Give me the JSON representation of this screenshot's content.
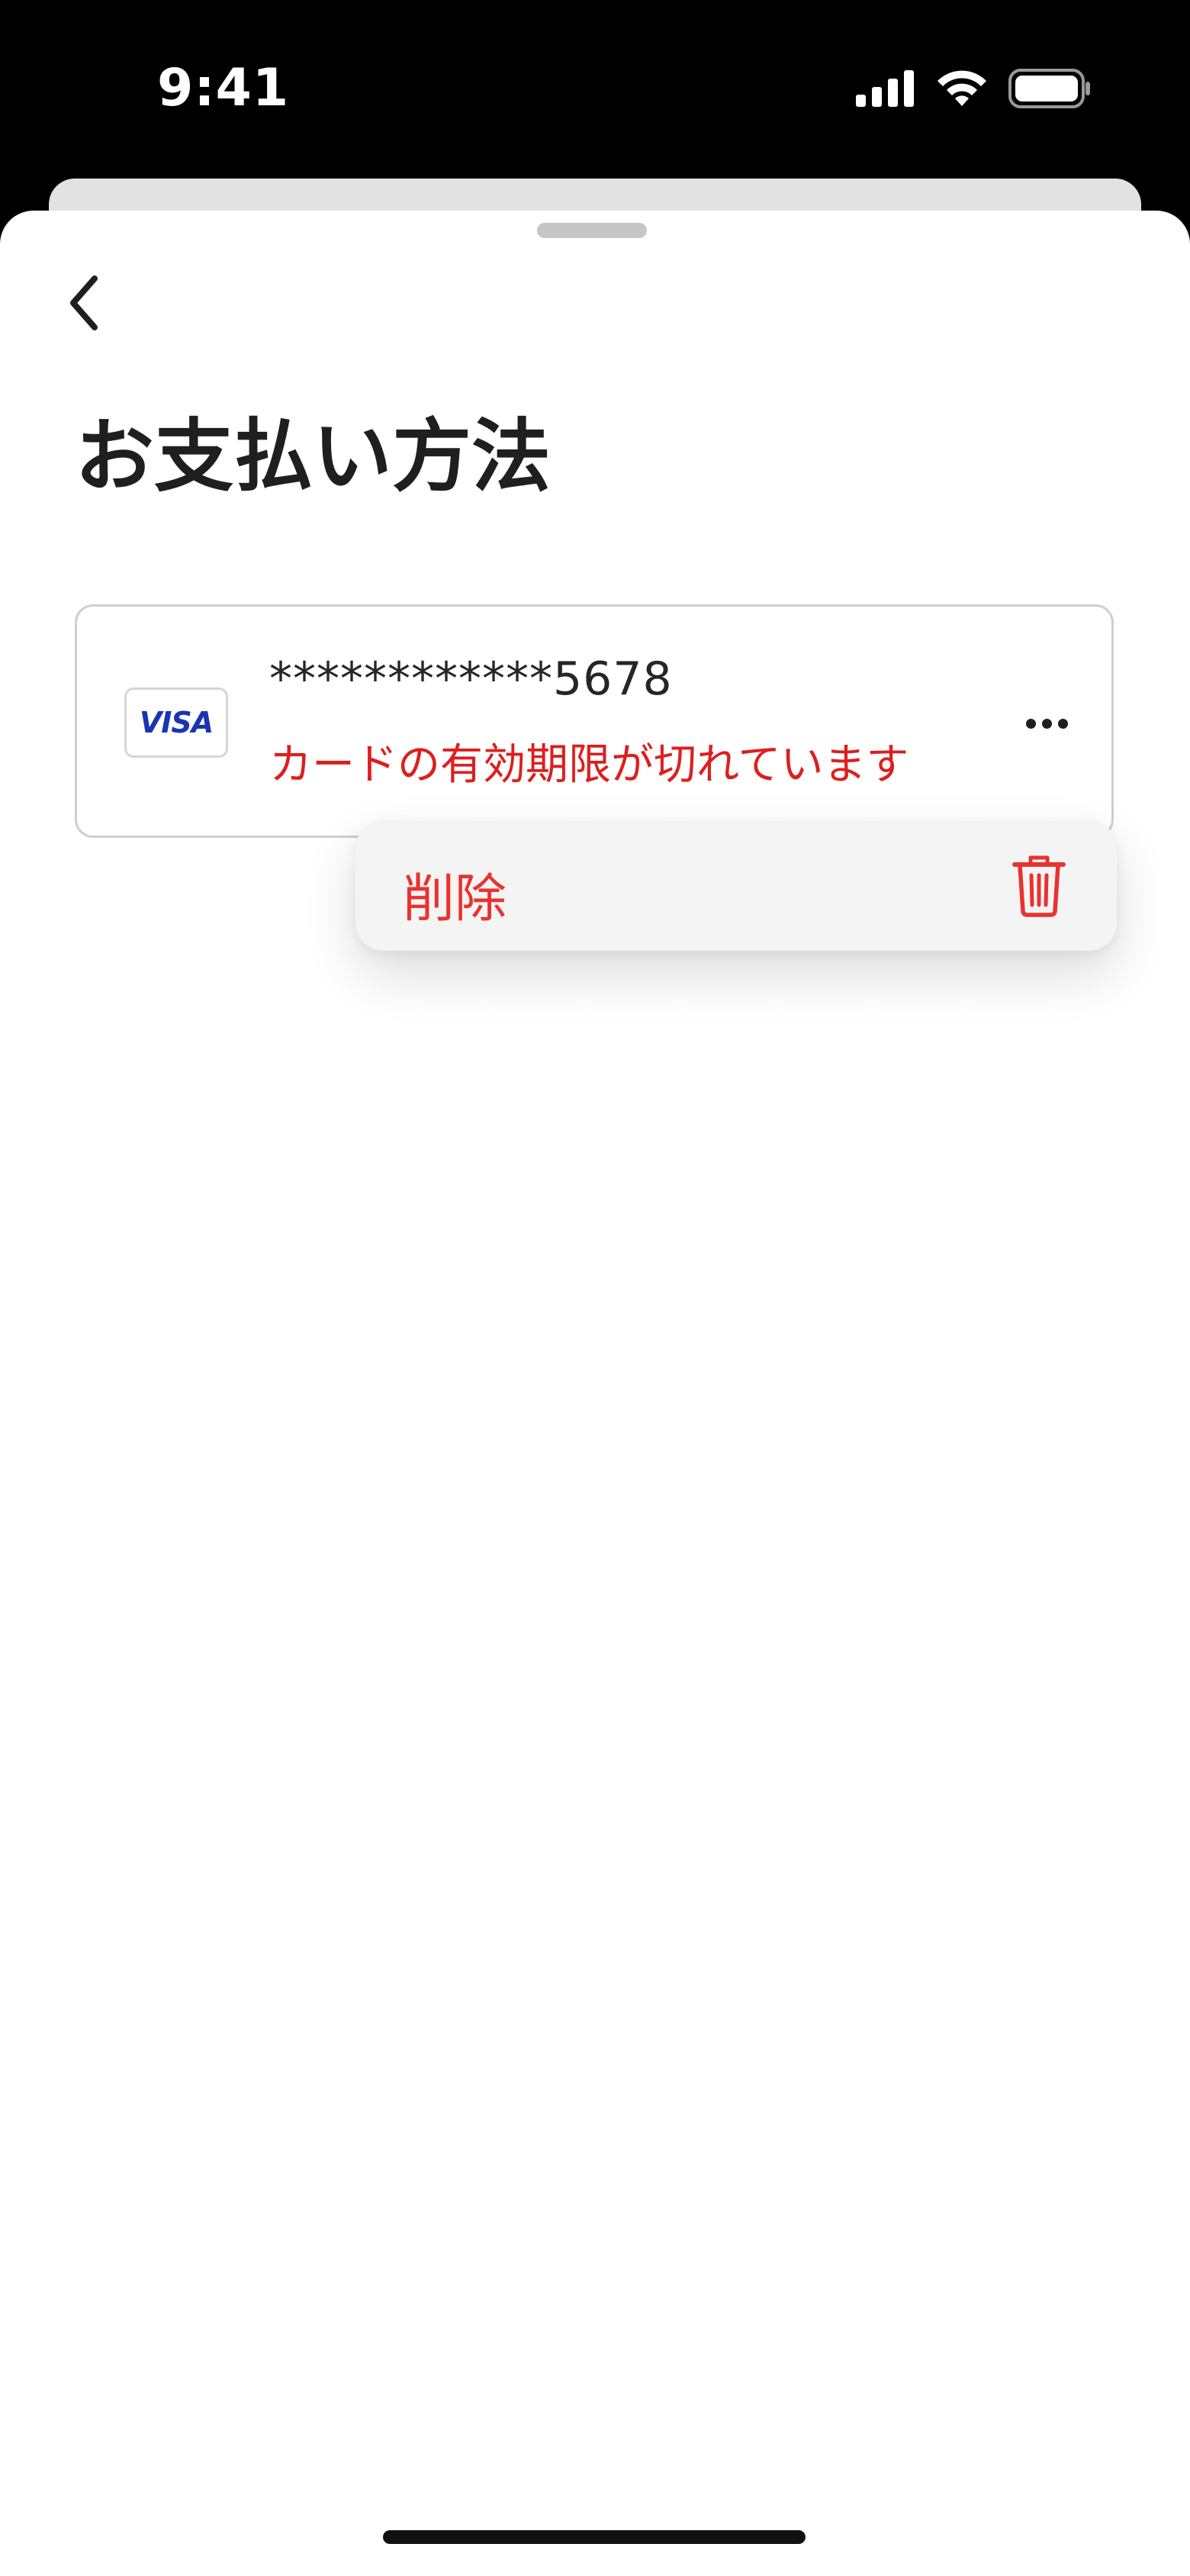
{
  "status_bar": {
    "time": "9:41",
    "icons": [
      "cellular-signal-icon",
      "wifi-icon",
      "battery-icon"
    ]
  },
  "header": {
    "back_icon": "chevron-left-icon",
    "title": "お支払い方法"
  },
  "payment_methods": [
    {
      "brand": "VISA",
      "brand_color": "#1a34b3",
      "masked_number": "************5678",
      "error_message": "カードの有効期限が切れています",
      "error_color": "#dc1f1f",
      "more_icon": "ellipsis-icon"
    }
  ],
  "context_menu": {
    "items": [
      {
        "label": "削除",
        "icon": "trash-icon",
        "color": "#e8332f"
      }
    ]
  }
}
